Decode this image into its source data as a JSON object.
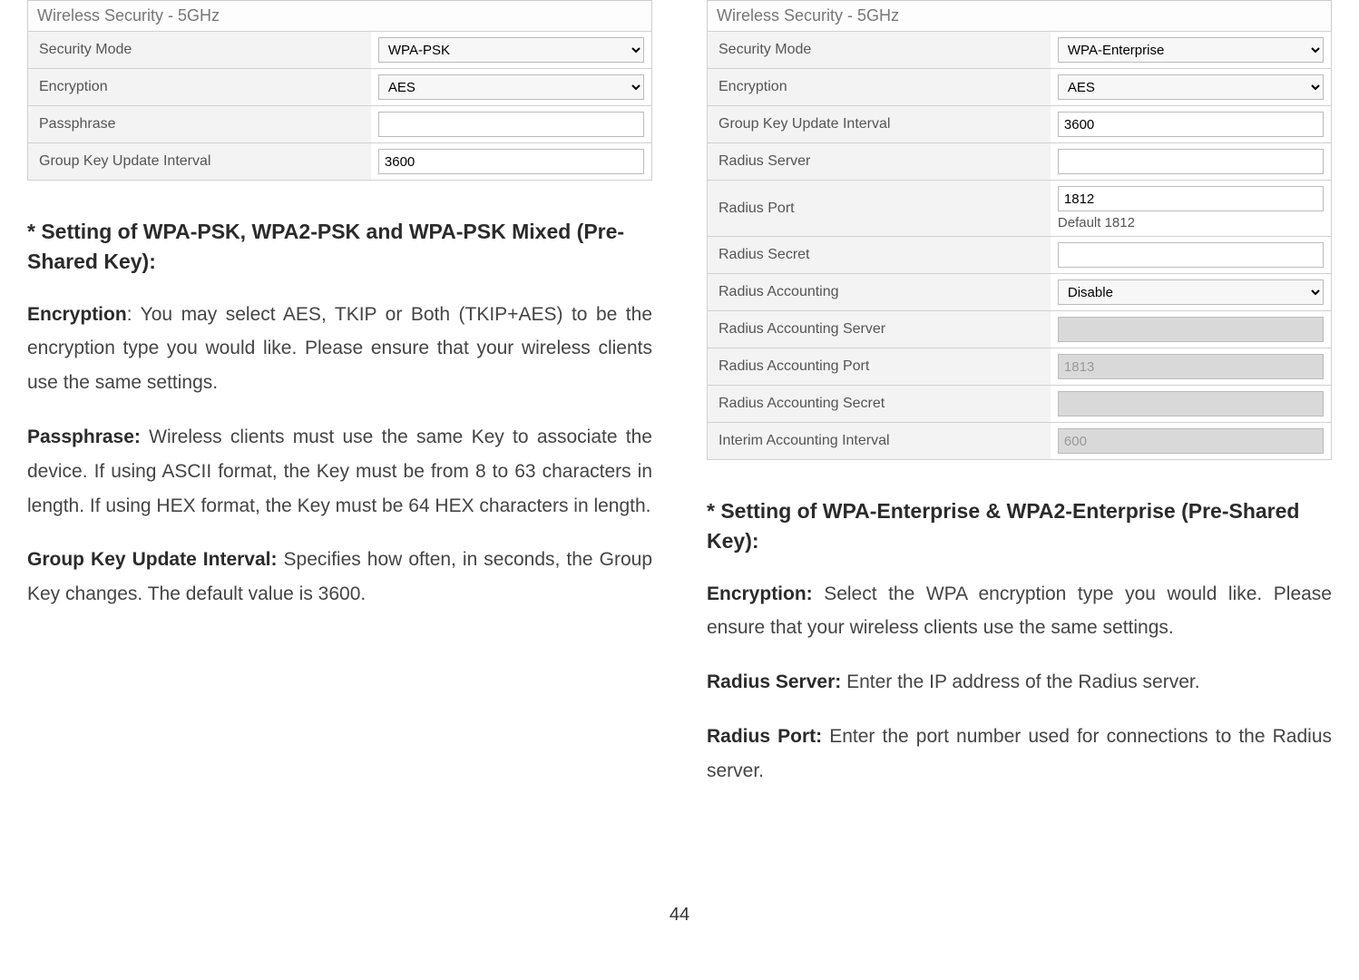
{
  "pageNumber": "44",
  "left": {
    "table": {
      "title": "Wireless Security - 5GHz",
      "rows": [
        {
          "label": "Security Mode",
          "type": "select",
          "value": "WPA-PSK"
        },
        {
          "label": "Encryption",
          "type": "select",
          "value": "AES"
        },
        {
          "label": "Passphrase",
          "type": "text",
          "value": ""
        },
        {
          "label": "Group Key Update Interval",
          "type": "text",
          "value": "3600"
        }
      ]
    },
    "heading": "* Setting of WPA-PSK, WPA2-PSK and WPA-PSK Mixed (Pre-Shared Key):",
    "paras": [
      {
        "bold": "Encryption",
        "boldSuffix": ":",
        "text": " You may select AES, TKIP or Both (TKIP+AES) to be the encryption type you would like. Please ensure that your wireless clients use the same settings."
      },
      {
        "bold": "Passphrase:",
        "boldSuffix": "",
        "text": " Wireless clients must use the same Key to associate the device. If using ASCII format, the Key must be from 8 to 63 characters in length. If using HEX format, the Key must be 64 HEX characters in length."
      },
      {
        "bold": "Group Key Update Interval:",
        "boldSuffix": "",
        "text": " Specifies how often, in seconds, the Group Key changes. The default value is 3600."
      }
    ]
  },
  "right": {
    "table": {
      "title": "Wireless Security - 5GHz",
      "rows": [
        {
          "label": "Security Mode",
          "type": "select",
          "value": "WPA-Enterprise"
        },
        {
          "label": "Encryption",
          "type": "select",
          "value": "AES"
        },
        {
          "label": "Group Key Update Interval",
          "type": "text",
          "value": "3600"
        },
        {
          "label": "Radius Server",
          "type": "text",
          "value": ""
        },
        {
          "label": "Radius Port",
          "type": "text",
          "value": "1812",
          "hint": "Default 1812"
        },
        {
          "label": "Radius Secret",
          "type": "text",
          "value": ""
        },
        {
          "label": "Radius Accounting",
          "type": "select",
          "value": "Disable"
        },
        {
          "label": "Radius Accounting Server",
          "type": "text",
          "value": "",
          "disabled": true
        },
        {
          "label": "Radius Accounting Port",
          "type": "text",
          "value": "1813",
          "disabled": true
        },
        {
          "label": "Radius Accounting Secret",
          "type": "text",
          "value": "",
          "disabled": true
        },
        {
          "label": "Interim Accounting Interval",
          "type": "text",
          "value": "600",
          "disabled": true
        }
      ]
    },
    "heading": "* Setting of WPA-Enterprise & WPA2-Enterprise (Pre-Shared Key):",
    "paras": [
      {
        "bold": "Encryption:",
        "text": " Select the WPA encryption type you would like. Please ensure that your wireless clients use the same settings."
      },
      {
        "bold": "Radius Server:",
        "text": " Enter the IP address of the Radius server."
      },
      {
        "bold": "Radius Port:",
        "text": " Enter the port number used for connections to the Radius server."
      }
    ]
  }
}
